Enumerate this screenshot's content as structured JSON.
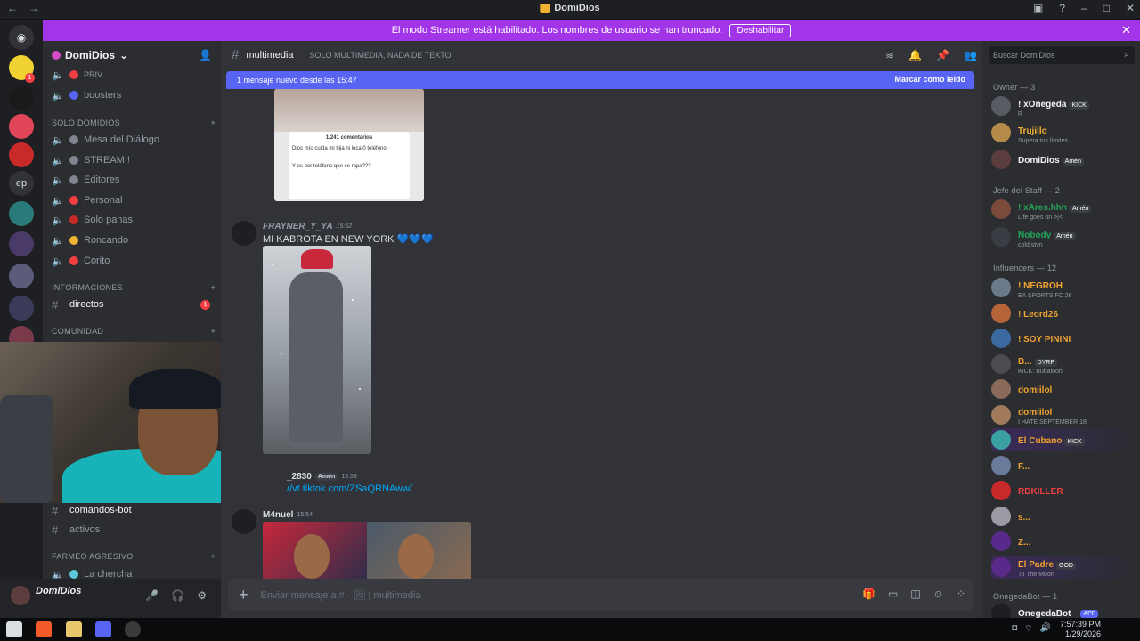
{
  "window": {
    "title": "DomiDios"
  },
  "banner": {
    "text": "El modo Streamer está habilitado. Los nombres de usuario se han truncado.",
    "button": "Deshabilitar"
  },
  "server": {
    "name": "DomiDios"
  },
  "channels": {
    "top": [
      {
        "label": "PRIV",
        "color": "#f23f43"
      },
      {
        "label": "boosters",
        "color": "#5865f2"
      }
    ],
    "category_solo": "SOLO DOMIDIOS",
    "solo": [
      {
        "label": "Mesa del Diálogo"
      },
      {
        "label": "STREAM !"
      },
      {
        "label": "Editores"
      },
      {
        "label": "Personal"
      },
      {
        "label": "Solo panas"
      },
      {
        "label": "Roncando"
      },
      {
        "label": "Corito"
      }
    ],
    "category_info": "INFORMACIONES",
    "directos": "directos",
    "directos_badge": "1",
    "category_comunidad": "COMUNIDAD",
    "comandos": "comandos-bot",
    "activos": "activos",
    "category_farmeo": "FARMEO AGRESIVO",
    "chercha": "La chercha"
  },
  "user_panel": {
    "name": "DomiDios"
  },
  "main": {
    "channel": "multimedia",
    "topic": "SOLO MULTIMEDIA, NADA DE TEXTO",
    "newbar": "1 mensaje nuevo desde las 15:47",
    "newbar_action": "Marcar como leído",
    "img1": {
      "count": "1,241 comentarios",
      "c1": "Dios mío cuida mi hija ni loca 0 teléfono",
      "c2": "Y es por teléfono que se rapa???"
    },
    "msg1": {
      "author": "FRAYNER_Y_YA",
      "time": "15:52",
      "text": "MI KABROTA EN NEW YORK 💙💙💙"
    },
    "msg2": {
      "author": "_2830",
      "role": "Amén",
      "time": "15:53",
      "link": "//vt.tiktok.com/ZSaQRNAww/"
    },
    "msg3": {
      "author": "M4nuel",
      "time": "15:54"
    },
    "composer": "Enviar mensaje a # · 🖼 | multimedia"
  },
  "members": {
    "search": "Buscar DomiDios",
    "owner_header": "Owner — 3",
    "owners": [
      {
        "name": "! xOnegeda",
        "tag": "KICK",
        "sub": "R",
        "color": "#f2f3f5",
        "av": "#5a5c63"
      },
      {
        "name": "Trujillo",
        "sub": "Supera tus límites",
        "color": "#f0b232",
        "av": "#b58b4a"
      },
      {
        "name": "DomiDios",
        "tag": "Amén",
        "sub": "",
        "color": "#f2f3f5",
        "av": "#5c3d3d"
      }
    ],
    "staff_header": "Jefe del Staff — 2",
    "staff": [
      {
        "name": "! xAres.hhh",
        "tag": "Amén",
        "sub": "Life goes on >|<",
        "color": "#23a559",
        "av": "#7a4a3a"
      },
      {
        "name": "Nobody",
        "tag": "Amén",
        "sub": "cold.stvn",
        "color": "#23a559",
        "av": "#3b3d44"
      }
    ],
    "influ_header": "Influencers — 12",
    "influencers": [
      {
        "name": "! NEGROH",
        "sub": "EA SPORTS FC 26",
        "color": "#f0a232",
        "av": "#6a7a8a"
      },
      {
        "name": "! Leord26",
        "sub": "",
        "color": "#f0a232",
        "av": "#b5643a"
      },
      {
        "name": "! SOY PININI",
        "sub": "",
        "color": "#f0a232",
        "av": "#3a6aa0"
      },
      {
        "name": "B...",
        "tag": "DYRP",
        "sub": "KICK: Bubalooh",
        "color": "#f0a232",
        "av": "#4a4c52"
      },
      {
        "name": "domiilol",
        "sub": "",
        "color": "#f0a232",
        "av": "#8a6a5a"
      },
      {
        "name": "domiilol",
        "sub": "I HATE SEPTEMBER 18",
        "color": "#f0a232",
        "av": "#a07a5a"
      },
      {
        "name": "El Cubano",
        "tag": "KICK",
        "sub": "",
        "color": "#f0a232",
        "av": "#3aa0a0",
        "hl": true
      },
      {
        "name": "F...",
        "sub": "",
        "color": "#f0a232",
        "av": "#6a7a9a"
      },
      {
        "name": "RDKILLER",
        "sub": "",
        "color": "#f23f43",
        "av": "#c82a2a"
      },
      {
        "name": "s...",
        "sub": "",
        "color": "#f0a232",
        "av": "#9a9aa4"
      },
      {
        "name": "Z...",
        "sub": "",
        "color": "#f0a232",
        "av": "#5a2a8a"
      },
      {
        "name": "El Padre",
        "tag": "GOD",
        "sub": "To The Moon",
        "color": "#f0a232",
        "av": "#5a2a8a",
        "hl": true
      }
    ],
    "bot_header": "OnegedaBot — 1",
    "bot": {
      "name": "OnegedaBot",
      "tag": "APP"
    }
  },
  "taskbar": {
    "time": "7:57:39 PM",
    "date": "1/29/2026"
  }
}
